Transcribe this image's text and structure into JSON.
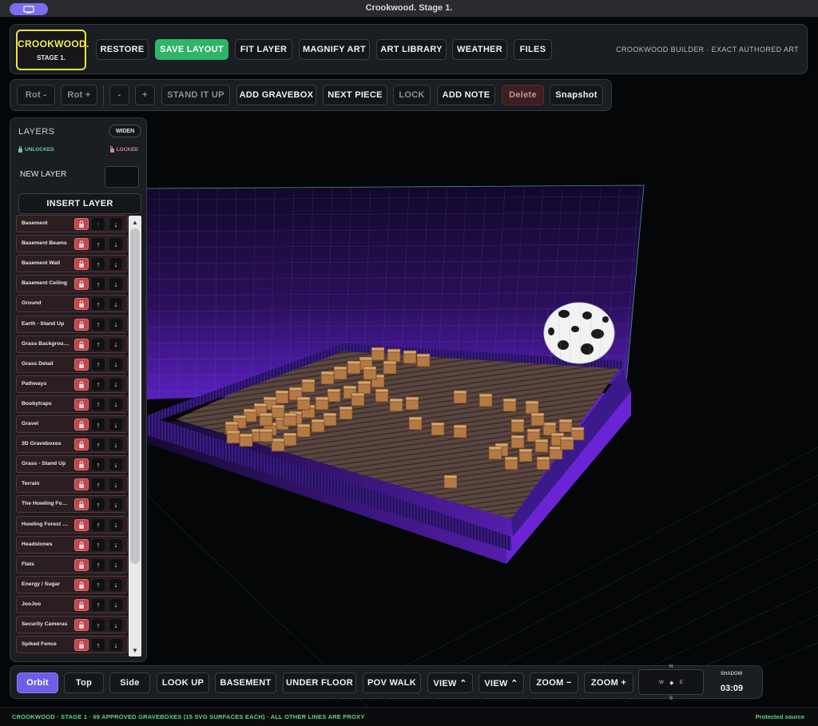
{
  "window": {
    "title": "Crookwood. Stage 1."
  },
  "logo": {
    "name": "CROOKWOOD.",
    "stage": "STAGE 1."
  },
  "toolbar": {
    "restore": "RESTORE",
    "save_layout": "SAVE LAYOUT",
    "fit_layer": "FIT LAYER",
    "magnify_art": "MAGNIFY ART",
    "art_library": "ART LIBRARY",
    "weather": "WEATHER",
    "files": "FILES",
    "builder_label": "CROOKWOOD BUILDER · EXACT AUTHORED ART"
  },
  "tools": {
    "rot_minus": "Rot -",
    "rot_plus": "Rot +",
    "minus": "-",
    "plus": "+",
    "stand_it_up": "STAND IT UP",
    "add_gravebox": "ADD GRAVEBOX",
    "next_piece": "NEXT PIECE",
    "lock": "LOCK",
    "add_note": "ADD NOTE",
    "delete": "Delete",
    "snapshot": "Snapshot"
  },
  "layers": {
    "title": "LAYERS",
    "widen": "WIDEN",
    "unlocked": "UNLOCKED",
    "locked": "LOCKED",
    "new_layer": "NEW LAYER",
    "new_layer_value": "",
    "insert": "INSERT LAYER",
    "items": [
      "Basement",
      "Basement Beams",
      "Basement Wall",
      "Basement Ceiling",
      "Ground",
      "Earth - Stand Up",
      "Grass Backgrou…",
      "Grass Detail",
      "Pathways",
      "Boobytraps",
      "Gravel",
      "3D Graveboxes",
      "Grass - Stand Up",
      "Terrain",
      "The Howling Fo…",
      "Howling Forest …",
      "Headstones",
      "Flats",
      "Energy / Sugar",
      "JooJoo",
      "Security Cameras",
      "Spiked Fence"
    ]
  },
  "view": {
    "orbit": "Orbit",
    "top": "Top",
    "side": "Side",
    "look_up": "LOOK UP",
    "basement": "BASEMENT",
    "under_floor": "UNDER FLOOR",
    "pov_walk": "POV WALK",
    "view_up": "VIEW ⌃",
    "view_down": "VIEW ⌃",
    "zoom_out": "ZOOM −",
    "zoom_in": "ZOOM +",
    "compass": {
      "n": "N",
      "s": "S",
      "w": "W",
      "e": "E"
    },
    "shadow_label": "SHADOW",
    "shadow_time": "03:09"
  },
  "status": {
    "left": "CROOKWOOD · STAGE 1 · 69 APPROVED GRAVEBOXES (15 SVG SURFACES EACH) · ALL OTHER LINES ARE PROXY",
    "right": "Protected source"
  },
  "colors": {
    "accent": "#6d5ee8",
    "save": "#2fb46a",
    "logo_border": "#f2e23c",
    "locked": "#c0474d",
    "status_text": "#5fd38e",
    "scene_purple": "#7a2fe0"
  }
}
